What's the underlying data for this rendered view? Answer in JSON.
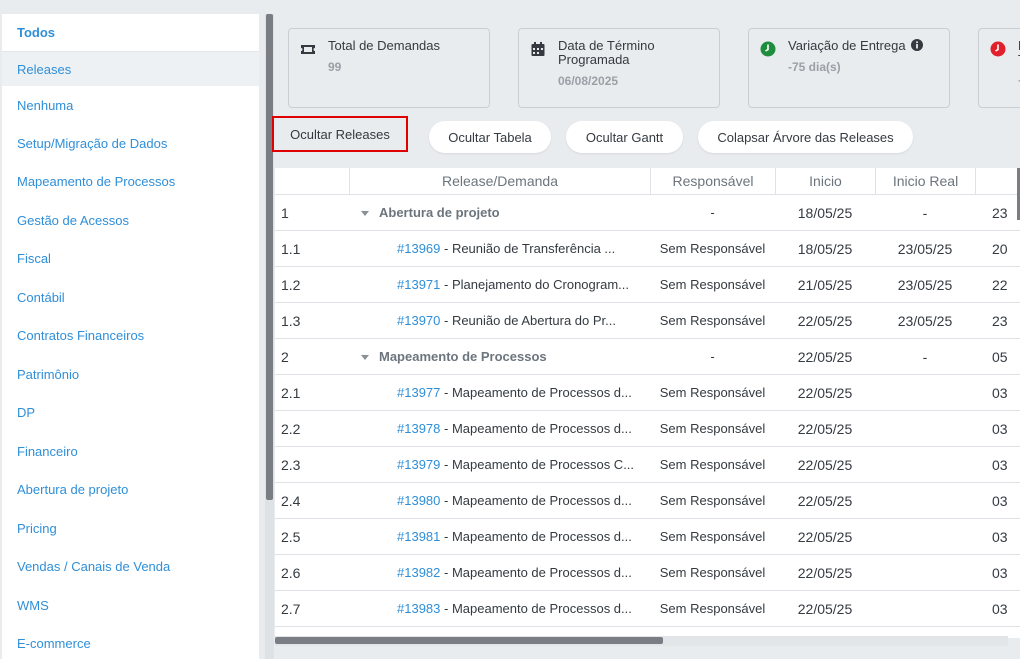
{
  "sidebar": {
    "items": [
      {
        "label": "Todos"
      },
      {
        "label": "Releases"
      },
      {
        "label": "Nenhuma"
      },
      {
        "label": "Setup/Migração de Dados"
      },
      {
        "label": "Mapeamento de Processos"
      },
      {
        "label": "Gestão de Acessos"
      },
      {
        "label": "Fiscal"
      },
      {
        "label": "Contábil"
      },
      {
        "label": "Contratos Financeiros"
      },
      {
        "label": "Patrimônio"
      },
      {
        "label": "DP"
      },
      {
        "label": "Financeiro"
      },
      {
        "label": "Abertura de projeto"
      },
      {
        "label": "Pricing"
      },
      {
        "label": "Vendas / Canais de Venda"
      },
      {
        "label": "WMS"
      },
      {
        "label": "E-commerce"
      }
    ]
  },
  "cards": {
    "total": {
      "title": "Total de Demandas",
      "value": "99",
      "icon": "ticket-icon"
    },
    "termino": {
      "title_line1": "Data de Término",
      "title_line2": "Programada",
      "value": "06/08/2025",
      "icon": "calendar-icon"
    },
    "variacao": {
      "title": "Variação de Entrega",
      "value": "-75 dia(s)",
      "icon": "clock-icon",
      "icon_color": "#1e8e3e"
    },
    "fourth": {
      "title_line1": "M",
      "title_line2": "T",
      "value": "+",
      "icon": "clock-icon",
      "icon_color": "#e0212b"
    }
  },
  "toolbar": {
    "hide_releases": "Ocultar Releases",
    "hide_table": "Ocultar Tabela",
    "hide_gantt": "Ocultar Gantt",
    "collapse_tree": "Colapsar Árvore das Releases"
  },
  "table": {
    "headers": {
      "name": "Release/Demanda",
      "resp": "Responsável",
      "inicio": "Inicio",
      "inicio_real": "Inicio Real"
    },
    "rows": [
      {
        "num": "1",
        "group": true,
        "name": "Abertura de projeto",
        "resp": "-",
        "inicio": "18/05/25",
        "real": "-",
        "next": "23"
      },
      {
        "num": "1.1",
        "id": "#13969",
        "name": " - Reunião de Transferência ...",
        "resp": "Sem Responsável",
        "inicio": "18/05/25",
        "real": "23/05/25",
        "next": "20"
      },
      {
        "num": "1.2",
        "id": "#13971",
        "name": " - Planejamento do Cronogram...",
        "resp": "Sem Responsável",
        "inicio": "21/05/25",
        "real": "23/05/25",
        "next": "22"
      },
      {
        "num": "1.3",
        "id": "#13970",
        "name": " - Reunião de Abertura do Pr...",
        "resp": "Sem Responsável",
        "inicio": "22/05/25",
        "real": "23/05/25",
        "next": "23"
      },
      {
        "num": "2",
        "group": true,
        "name": "Mapeamento de Processos",
        "resp": "-",
        "inicio": "22/05/25",
        "real": "-",
        "next": "05"
      },
      {
        "num": "2.1",
        "id": "#13977",
        "name": " - Mapeamento de Processos d...",
        "resp": "Sem Responsável",
        "inicio": "22/05/25",
        "real": "",
        "next": "03"
      },
      {
        "num": "2.2",
        "id": "#13978",
        "name": " - Mapeamento de Processos d...",
        "resp": "Sem Responsável",
        "inicio": "22/05/25",
        "real": "",
        "next": "03"
      },
      {
        "num": "2.3",
        "id": "#13979",
        "name": " - Mapeamento de Processos C...",
        "resp": "Sem Responsável",
        "inicio": "22/05/25",
        "real": "",
        "next": "03"
      },
      {
        "num": "2.4",
        "id": "#13980",
        "name": " - Mapeamento de Processos d...",
        "resp": "Sem Responsável",
        "inicio": "22/05/25",
        "real": "",
        "next": "03"
      },
      {
        "num": "2.5",
        "id": "#13981",
        "name": " - Mapeamento de Processos d...",
        "resp": "Sem Responsável",
        "inicio": "22/05/25",
        "real": "",
        "next": "03"
      },
      {
        "num": "2.6",
        "id": "#13982",
        "name": " - Mapeamento de Processos d...",
        "resp": "Sem Responsável",
        "inicio": "22/05/25",
        "real": "",
        "next": "03"
      },
      {
        "num": "2.7",
        "id": "#13983",
        "name": " - Mapeamento de Processos d...",
        "resp": "Sem Responsável",
        "inicio": "22/05/25",
        "real": "",
        "next": "03"
      }
    ]
  }
}
